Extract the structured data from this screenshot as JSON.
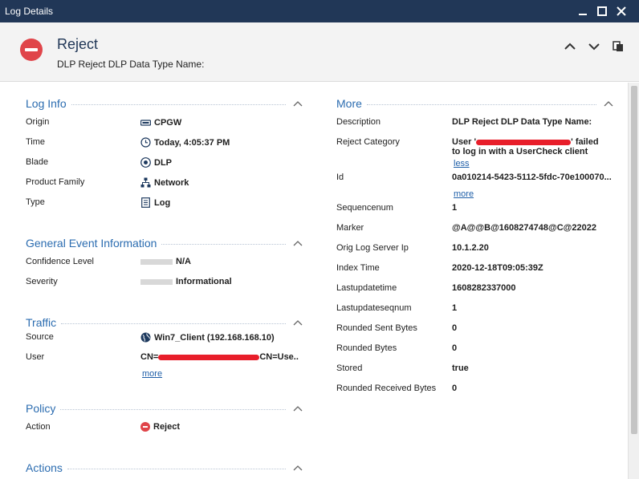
{
  "window": {
    "title": "Log Details"
  },
  "header": {
    "title": "Reject",
    "subtitle": "DLP Reject DLP Data Type Name:"
  },
  "log_info": {
    "title": "Log Info",
    "rows": [
      {
        "label": "Origin",
        "value": "CPGW",
        "icon": "gateway-icon"
      },
      {
        "label": "Time",
        "value": "Today, 4:05:37 PM",
        "icon": "clock-icon"
      },
      {
        "label": "Blade",
        "value": "DLP",
        "icon": "dlp-icon"
      },
      {
        "label": "Product Family",
        "value": "Network",
        "icon": "network-icon"
      },
      {
        "label": "Type",
        "value": "Log",
        "icon": "log-icon"
      }
    ]
  },
  "general": {
    "title": "General Event Information",
    "rows": [
      {
        "label": "Confidence Level",
        "value": "N/A"
      },
      {
        "label": "Severity",
        "value": "Informational"
      }
    ]
  },
  "traffic": {
    "title": "Traffic",
    "source_label": "Source",
    "source_value": "Win7_Client (192.168.168.10)",
    "user_label": "User",
    "user_value_prefix": "CN=",
    "user_value_suffix": "CN=Use..",
    "more": "more"
  },
  "policy": {
    "title": "Policy",
    "action_label": "Action",
    "action_value": "Reject"
  },
  "actions": {
    "title": "Actions"
  },
  "more_section": {
    "title": "More",
    "description_label": "Description",
    "description_value": "DLP Reject DLP Data Type Name:",
    "reject_label": "Reject Category",
    "reject_value_prefix": "User '",
    "reject_value_suffix": "' failed",
    "reject_value_line2": "to log in with a UserCheck client",
    "less": "less",
    "id_label": "Id",
    "id_value": "0a010214-5423-5112-5fdc-70e100070...",
    "id_more": "more",
    "rows": [
      {
        "label": "Sequencenum",
        "value": "1"
      },
      {
        "label": "Marker",
        "value": "@A@@B@1608274748@C@22022"
      },
      {
        "label": "Orig Log Server Ip",
        "value": "10.1.2.20"
      },
      {
        "label": "Index Time",
        "value": "2020-12-18T09:05:39Z"
      },
      {
        "label": "Lastupdatetime",
        "value": "1608282337000"
      },
      {
        "label": "Lastupdateseqnum",
        "value": "1"
      },
      {
        "label": "Rounded Sent Bytes",
        "value": "0"
      },
      {
        "label": "Rounded Bytes",
        "value": "0"
      },
      {
        "label": "Stored",
        "value": "true"
      },
      {
        "label": "Rounded Received Bytes",
        "value": "0"
      }
    ]
  },
  "colors": {
    "titlebar": "#213757",
    "section_title": "#2b6cb0",
    "reject_red": "#e0454a",
    "link": "#1f5fa8"
  }
}
